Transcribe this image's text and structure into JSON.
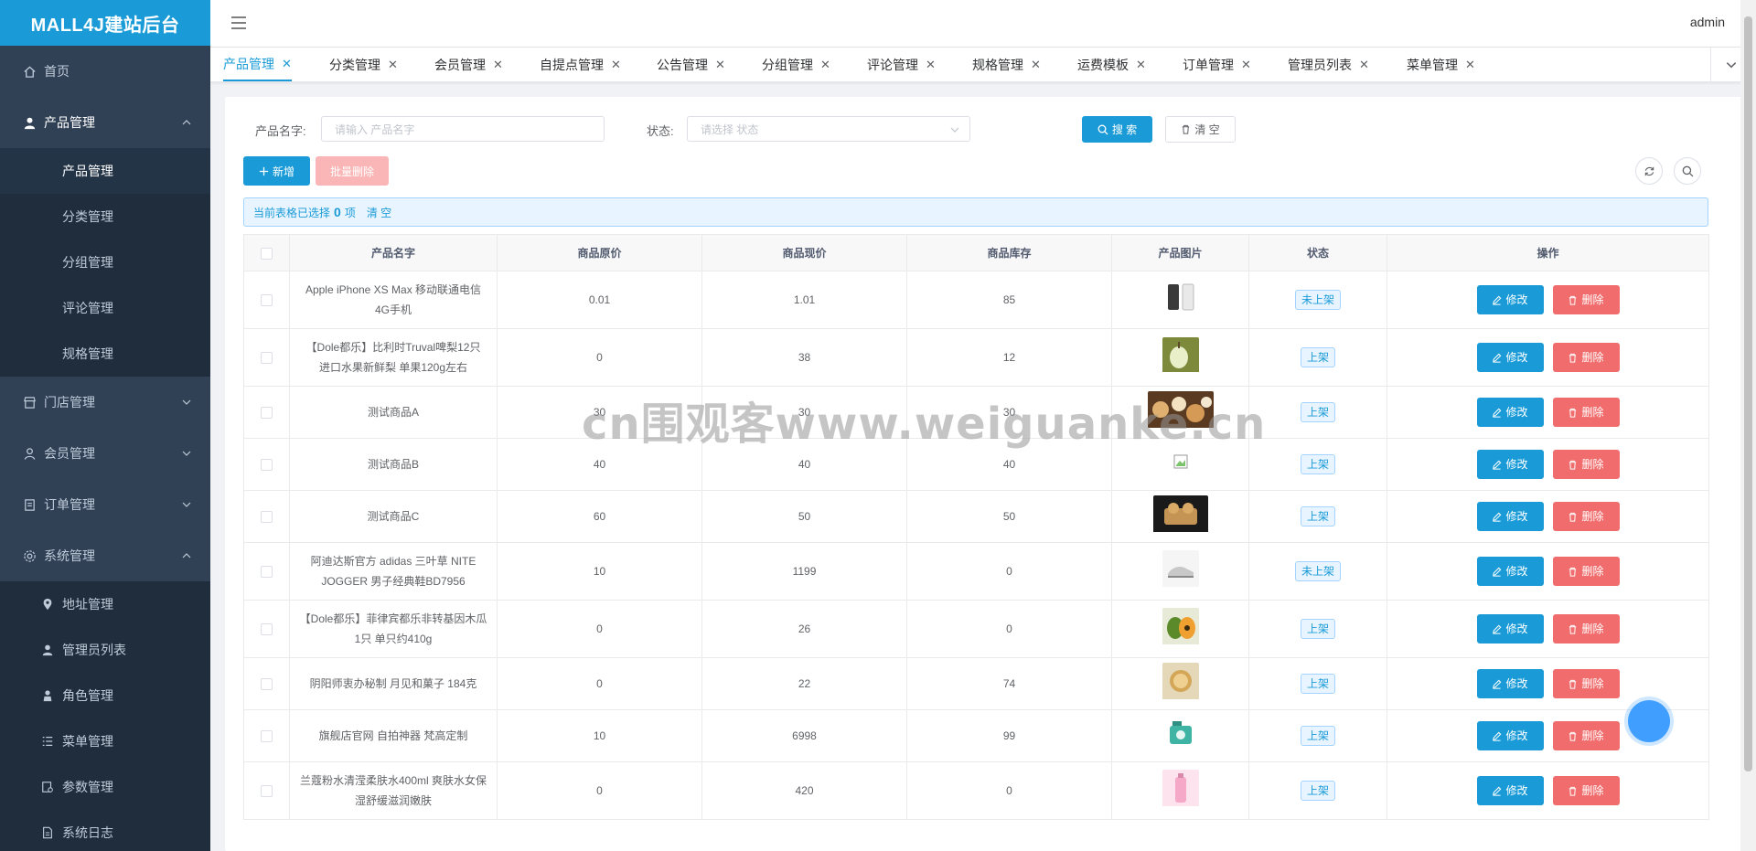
{
  "app": {
    "title": "MALL4J建站后台",
    "user": "admin"
  },
  "sidebar": {
    "home": "首页",
    "product": {
      "label": "产品管理",
      "children": [
        "产品管理",
        "分类管理",
        "分组管理",
        "评论管理",
        "规格管理"
      ]
    },
    "store": "门店管理",
    "member": "会员管理",
    "order": "订单管理",
    "system": {
      "label": "系统管理",
      "children": [
        "地址管理",
        "管理员列表",
        "角色管理",
        "菜单管理",
        "参数管理",
        "系统日志"
      ]
    }
  },
  "tabs": [
    "产品管理",
    "分类管理",
    "会员管理",
    "自提点管理",
    "公告管理",
    "分组管理",
    "评论管理",
    "规格管理",
    "运费模板",
    "订单管理",
    "管理员列表",
    "菜单管理"
  ],
  "search": {
    "name_label": "产品名字:",
    "name_placeholder": "请输入 产品名字",
    "status_label": "状态:",
    "status_placeholder": "请选择 状态",
    "search_btn": "搜 索",
    "clear_btn": "清 空"
  },
  "toolbar": {
    "add_btn": "新增",
    "batch_delete_btn": "批量删除"
  },
  "selection": {
    "prefix": "当前表格已选择",
    "count": "0",
    "suffix": "项",
    "clear": "清 空"
  },
  "table": {
    "headers": [
      "产品名字",
      "商品原价",
      "商品现价",
      "商品库存",
      "产品图片",
      "状态",
      "操作"
    ],
    "edit_label": "修改",
    "delete_label": "删除",
    "rows": [
      {
        "name": "Apple iPhone XS Max 移动联通电信4G手机",
        "orig": "0.01",
        "price": "1.01",
        "stock": "85",
        "status": "未上架",
        "img": "phone"
      },
      {
        "name": "【Dole都乐】比利时Truval啤梨12只 进口水果新鲜梨 单果120g左右",
        "orig": "0",
        "price": "38",
        "stock": "12",
        "status": "上架",
        "img": "pear"
      },
      {
        "name": "测试商品A",
        "orig": "30",
        "price": "30",
        "stock": "30",
        "status": "上架",
        "img": "snack"
      },
      {
        "name": "测试商品B",
        "orig": "40",
        "price": "40",
        "stock": "40",
        "status": "上架",
        "img": "broken"
      },
      {
        "name": "测试商品C",
        "orig": "60",
        "price": "50",
        "stock": "50",
        "status": "上架",
        "img": "cake"
      },
      {
        "name": "阿迪达斯官方 adidas 三叶草 NITE JOGGER 男子经典鞋BD7956",
        "orig": "10",
        "price": "1199",
        "stock": "0",
        "status": "未上架",
        "img": "shoe"
      },
      {
        "name": "【Dole都乐】菲律宾都乐非转基因木瓜 1只 单只约410g",
        "orig": "0",
        "price": "26",
        "stock": "0",
        "status": "上架",
        "img": "papaya"
      },
      {
        "name": "阴阳师衷办秘制 月见和菓子 184克",
        "orig": "0",
        "price": "22",
        "stock": "74",
        "status": "上架",
        "img": "mooncake"
      },
      {
        "name": "旗舰店官网 自拍神器 梵高定制",
        "orig": "10",
        "price": "6998",
        "stock": "99",
        "status": "上架",
        "img": "camera"
      },
      {
        "name": "兰蔻粉水清滢柔肤水400ml 爽肤水女保湿舒缓滋润嫩肤",
        "orig": "0",
        "price": "420",
        "stock": "0",
        "status": "上架",
        "img": "lotion"
      }
    ]
  },
  "watermark": "cn围观客www.weiguanke.cn",
  "colors": {
    "primary": "#1a9bd7",
    "danger": "#f16c6c",
    "sidebar": "#304156",
    "sidebar_sub": "#1f2d3d"
  }
}
